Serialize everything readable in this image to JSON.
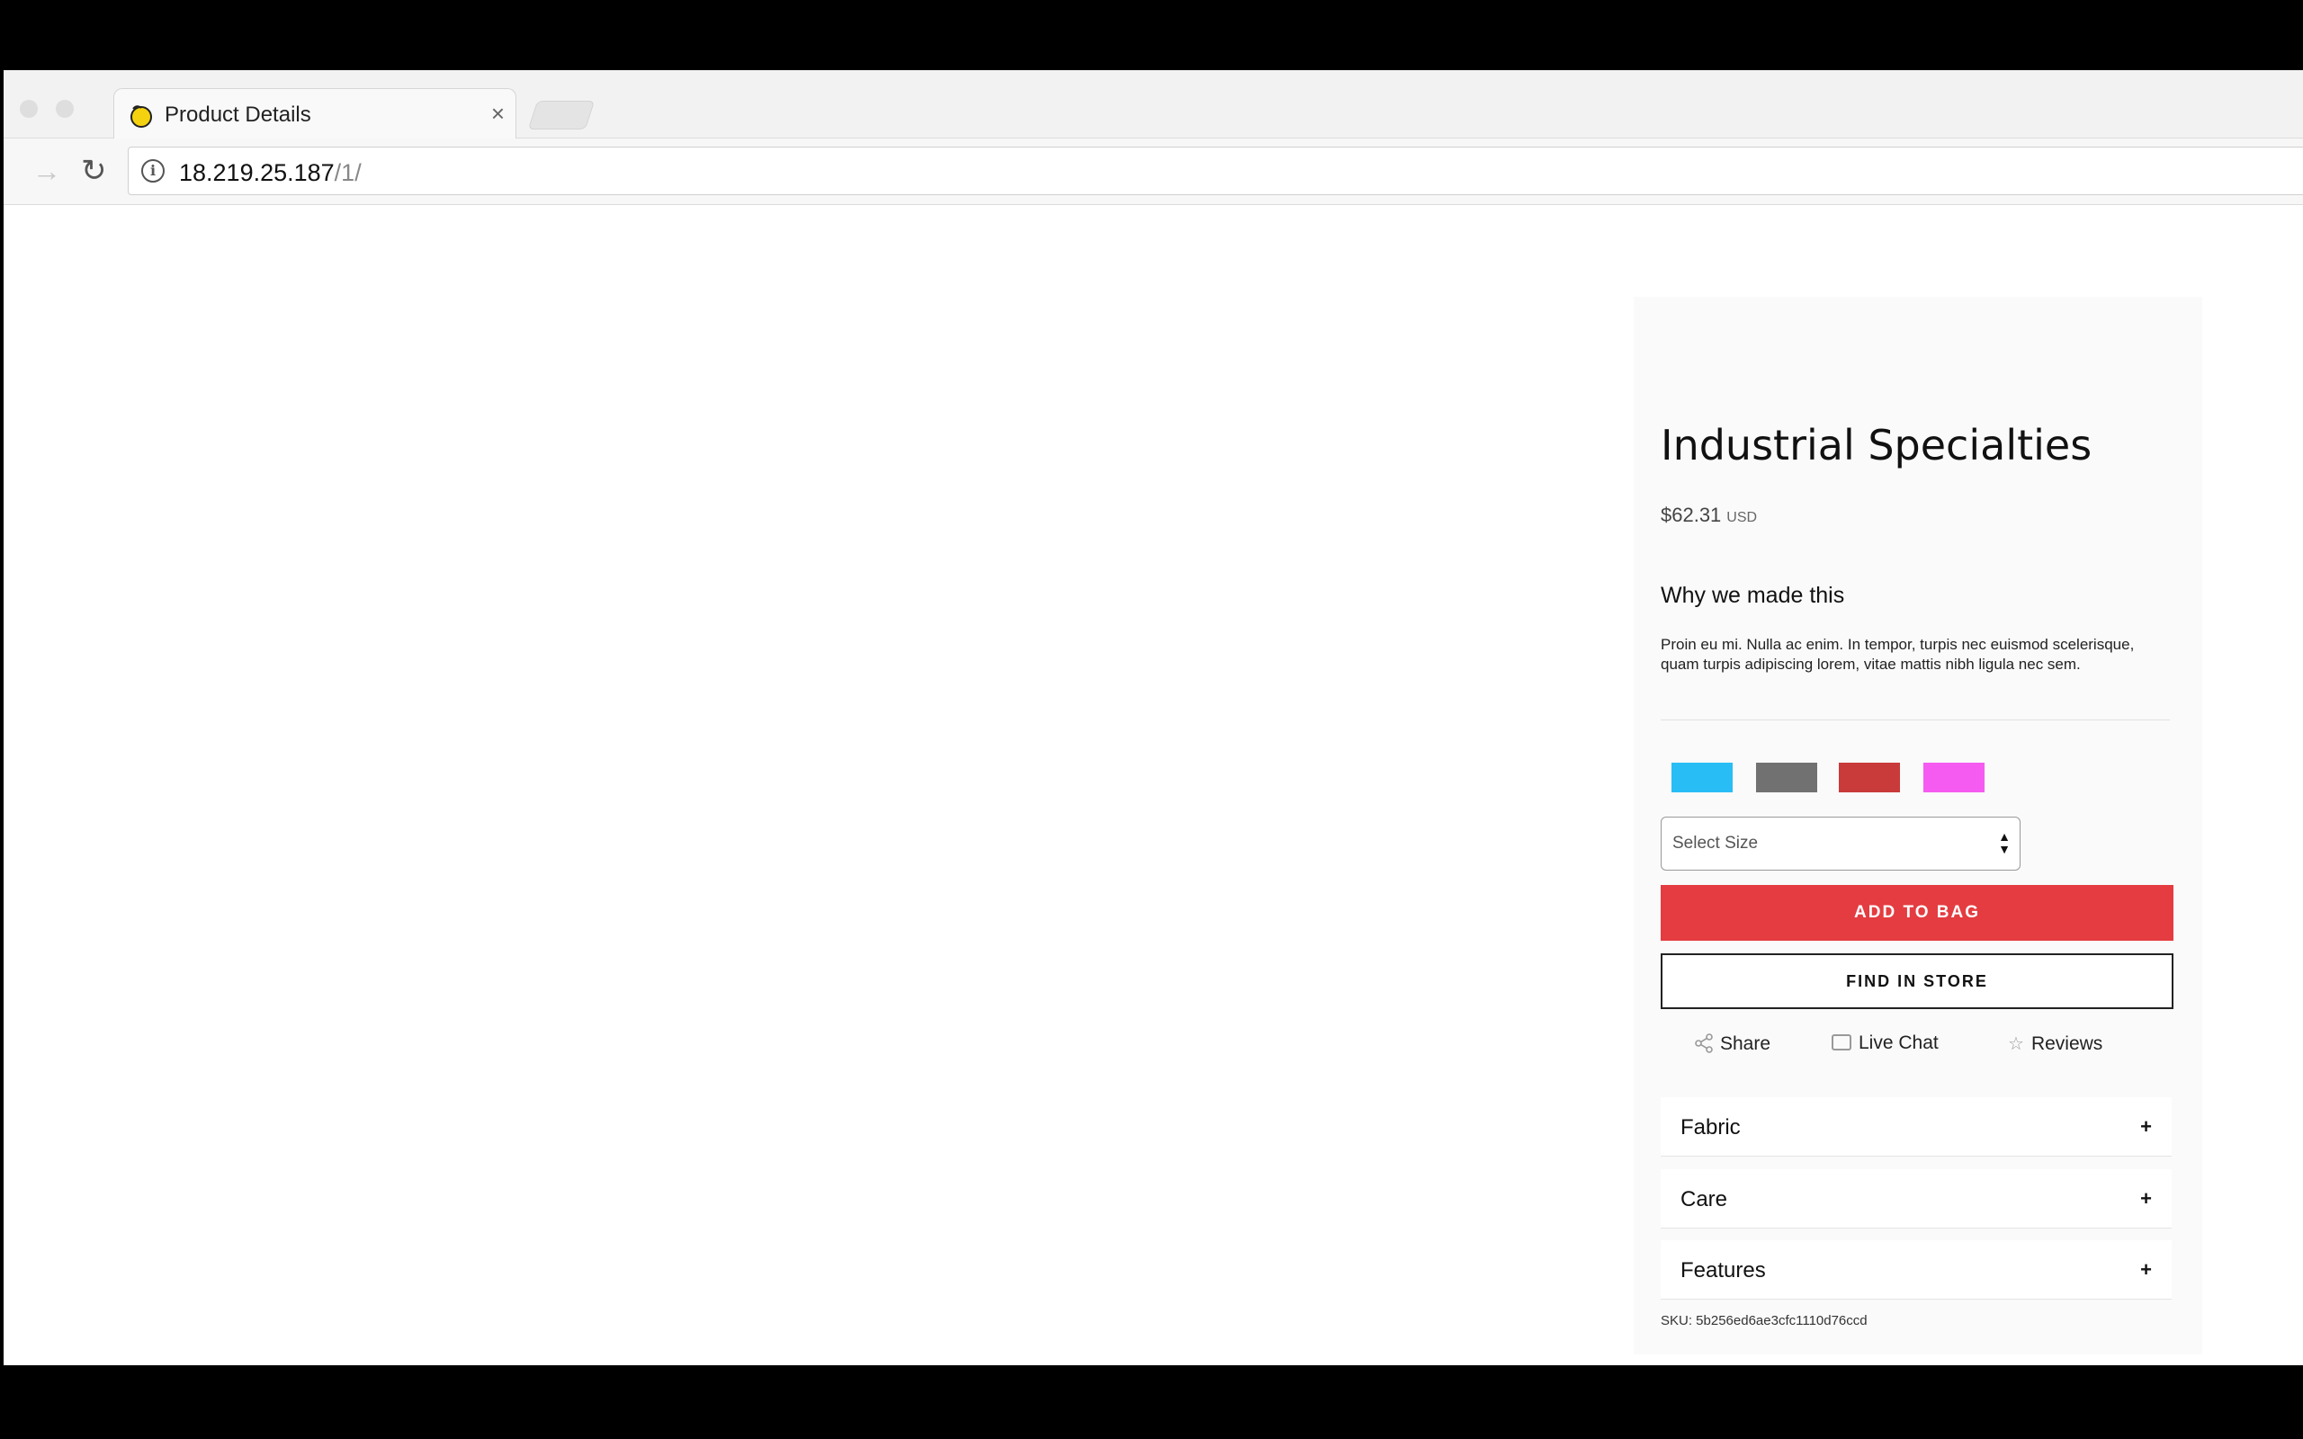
{
  "browser": {
    "tab_title": "Product Details",
    "tab_close": "×",
    "url_host": "18.219.25.187",
    "url_path": "/1/"
  },
  "product": {
    "title": "Industrial Specialties",
    "price": "$62.31",
    "currency": "USD",
    "why_heading": "Why we made this",
    "description": "Proin eu mi. Nulla ac enim. In tempor, turpis nec euismod scelerisque, quam turpis adipiscing lorem, vitae mattis nibh ligula nec sem.",
    "swatches": [
      "#29bdf5",
      "#717171",
      "#c93a3a",
      "#f55bf0"
    ],
    "size_placeholder": "Select Size",
    "add_to_bag": "ADD TO BAG",
    "add_to_bag_color": "#e43c40",
    "find_in_store": "FIND IN STORE",
    "actions": {
      "share": "Share",
      "live_chat": "Live Chat",
      "reviews": "Reviews"
    },
    "accordion": [
      {
        "label": "Fabric",
        "toggle": "+"
      },
      {
        "label": "Care",
        "toggle": "+"
      },
      {
        "label": "Features",
        "toggle": "+"
      }
    ],
    "sku": "SKU: 5b256ed6ae3cfc1110d76ccd"
  }
}
